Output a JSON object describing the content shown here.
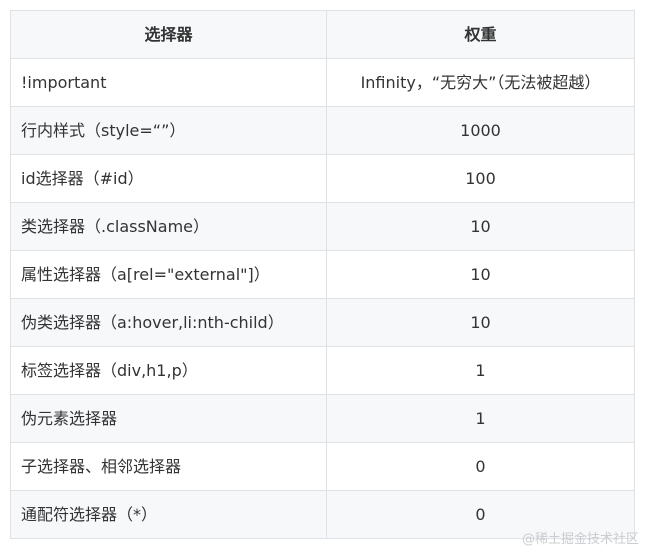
{
  "table": {
    "headers": {
      "selector": "选择器",
      "weight": "权重"
    },
    "rows": [
      {
        "selector": "!important",
        "weight": "Infinity，“无穷大”（无法被超越）"
      },
      {
        "selector": "行内样式（style=“”）",
        "weight": "1000"
      },
      {
        "selector": "id选择器（#id）",
        "weight": "100"
      },
      {
        "selector": "类选择器（.className）",
        "weight": "10"
      },
      {
        "selector": "属性选择器（a[rel=\"external\"]）",
        "weight": "10"
      },
      {
        "selector": "伪类选择器（a:hover,li:nth-child）",
        "weight": "10"
      },
      {
        "selector": "标签选择器（div,h1,p）",
        "weight": "1"
      },
      {
        "selector": "伪元素选择器",
        "weight": "1"
      },
      {
        "selector": "子选择器、相邻选择器",
        "weight": "0"
      },
      {
        "selector": "通配符选择器（*）",
        "weight": "0"
      }
    ]
  },
  "watermark": "@稀土掘金技术社区"
}
